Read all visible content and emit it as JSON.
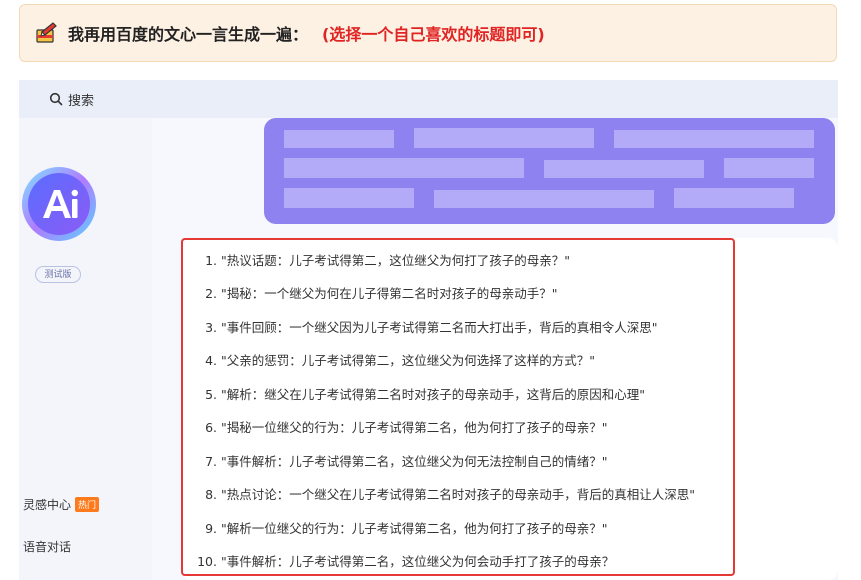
{
  "banner": {
    "title": "我再用百度的文心一言生成一遍：",
    "hint": "(选择一个自己喜欢的标题即可)"
  },
  "search": {
    "label": "搜索"
  },
  "sidebar": {
    "beta_badge": "测试版",
    "nav": [
      {
        "label": "灵感中心",
        "badge": "热门"
      },
      {
        "label": "语音对话"
      }
    ]
  },
  "chat": {
    "answer_items": [
      {
        "num": "1.",
        "text": "\"热议话题：儿子考试得第二，这位继父为何打了孩子的母亲？\""
      },
      {
        "num": "2.",
        "text": "\"揭秘：一个继父为何在儿子得第二名时对孩子的母亲动手？\""
      },
      {
        "num": "3.",
        "text": "\"事件回顾：一个继父因为儿子考试得第二名而大打出手，背后的真相令人深思\""
      },
      {
        "num": "4.",
        "text": "\"父亲的惩罚：儿子考试得第二，这位继父为何选择了这样的方式？\""
      },
      {
        "num": "5.",
        "text": "\"解析：继父在儿子考试得第二名时对孩子的母亲动手，这背后的原因和心理\""
      },
      {
        "num": "6.",
        "text": "\"揭秘一位继父的行为：儿子考试得第二名，他为何打了孩子的母亲？\""
      },
      {
        "num": "7.",
        "text": "\"事件解析：儿子考试得第二名，这位继父为何无法控制自己的情绪？\""
      },
      {
        "num": "8.",
        "text": "\"热点讨论：一个继父在儿子考试得第二名时对孩子的母亲动手，背后的真相让人深思\""
      },
      {
        "num": "9.",
        "text": "\"解析一位继父的行为：儿子考试得第二名，他为何打了孩子的母亲？\""
      },
      {
        "num": "10.",
        "text": "\"事件解析：儿子考试得第二名，这位继父为何会动手打了孩子的母亲？"
      }
    ]
  },
  "colors": {
    "banner_bg": "#fdf1e3",
    "hint_red": "#e02424",
    "frame_red": "#e53935",
    "bubble_purple": "#8d82ef",
    "hot_orange": "#ff7a1a"
  },
  "icons": {
    "banner": "notebook-pencil-icon",
    "search": "search-icon",
    "logo": "ai-logo-icon"
  }
}
